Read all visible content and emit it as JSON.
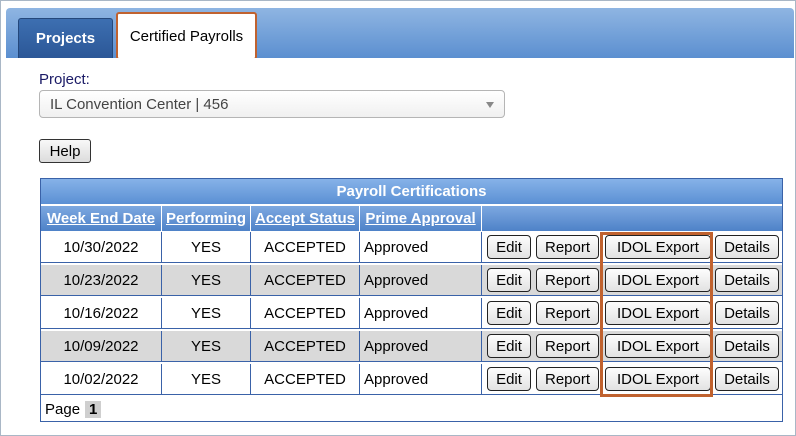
{
  "tabs": {
    "projects": "Projects",
    "certified_payrolls": "Certified Payrolls"
  },
  "project": {
    "label": "Project:",
    "selected": "IL Convention Center | 456"
  },
  "help_label": "Help",
  "table": {
    "title": "Payroll Certifications",
    "headers": [
      "Week End Date",
      "Performing",
      "Accept Status",
      "Prime Approval"
    ],
    "rows": [
      {
        "date": "10/30/2022",
        "performing": "YES",
        "status": "ACCEPTED",
        "approval": "Approved"
      },
      {
        "date": "10/23/2022",
        "performing": "YES",
        "status": "ACCEPTED",
        "approval": "Approved"
      },
      {
        "date": "10/16/2022",
        "performing": "YES",
        "status": "ACCEPTED",
        "approval": "Approved"
      },
      {
        "date": "10/09/2022",
        "performing": "YES",
        "status": "ACCEPTED",
        "approval": "Approved"
      },
      {
        "date": "10/02/2022",
        "performing": "YES",
        "status": "ACCEPTED",
        "approval": "Approved"
      }
    ],
    "actions": {
      "edit": "Edit",
      "report": "Report",
      "idol_export": "IDOL Export",
      "details": "Details"
    },
    "footer": {
      "page_label": "Page",
      "current_page": "1"
    }
  },
  "colors": {
    "highlight": "#c0622f",
    "tab_active_bg": "#2b5797",
    "header_blue": "#5b90d4",
    "row_alt": "#d9d9d9"
  }
}
